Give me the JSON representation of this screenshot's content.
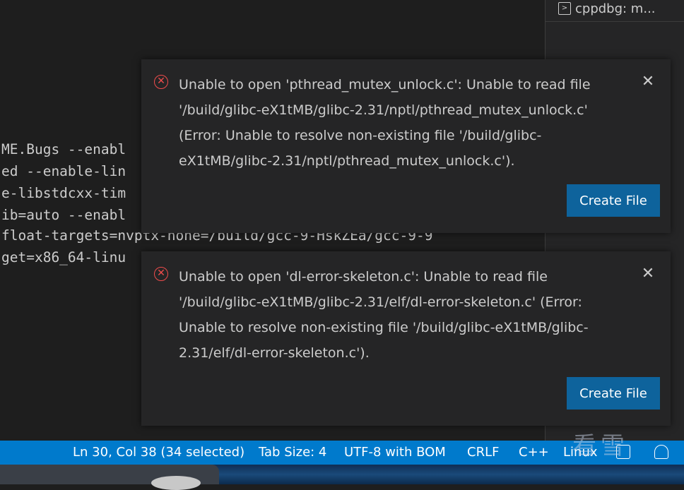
{
  "terminal": {
    "lines": [
      "ME.Bugs --enabl",
      "ed --enable-lin",
      "e-libstdcxx-tim",
      "ib=auto --enabl",
      "float-targets=nvptx-none=/build/gcc-9-HskZEa/gcc-9-9",
      "get=x86_64-linu"
    ]
  },
  "side_panel": {
    "tab_label": "cppdbg: m...",
    "tab_icon": "terminal-icon"
  },
  "notifications": [
    {
      "icon": "error-icon",
      "message": "Unable to open 'pthread_mutex_unlock.c': Unable to read file '/build/glibc-eX1tMB/glibc-2.31/nptl/pthread_mutex_unlock.c' (Error: Unable to resolve non-existing file '/build/glibc-eX1tMB/glibc-2.31/nptl/pthread_mutex_unlock.c').",
      "action": "Create File",
      "close_icon": "close-icon"
    },
    {
      "icon": "error-icon",
      "message": "Unable to open 'dl-error-skeleton.c': Unable to read file '/build/glibc-eX1tMB/glibc-2.31/elf/dl-error-skeleton.c' (Error: Unable to resolve non-existing file '/build/glibc-eX1tMB/glibc-2.31/elf/dl-error-skeleton.c').",
      "action": "Create File",
      "close_icon": "close-icon"
    }
  ],
  "status_bar": {
    "cursor": "Ln 30, Col 38 (34 selected)",
    "tab_size": "Tab Size: 4",
    "encoding": "UTF-8 with BOM",
    "eol": "CRLF",
    "language": "C++",
    "os": "Linux",
    "feedback_icon": "feedback-icon",
    "bell_icon": "bell-icon"
  },
  "watermark": "看雪",
  "colors": {
    "accent": "#007acc",
    "button": "#0e639c",
    "error": "#f14c4c",
    "background": "#1e1e1e",
    "toast": "#252526"
  }
}
